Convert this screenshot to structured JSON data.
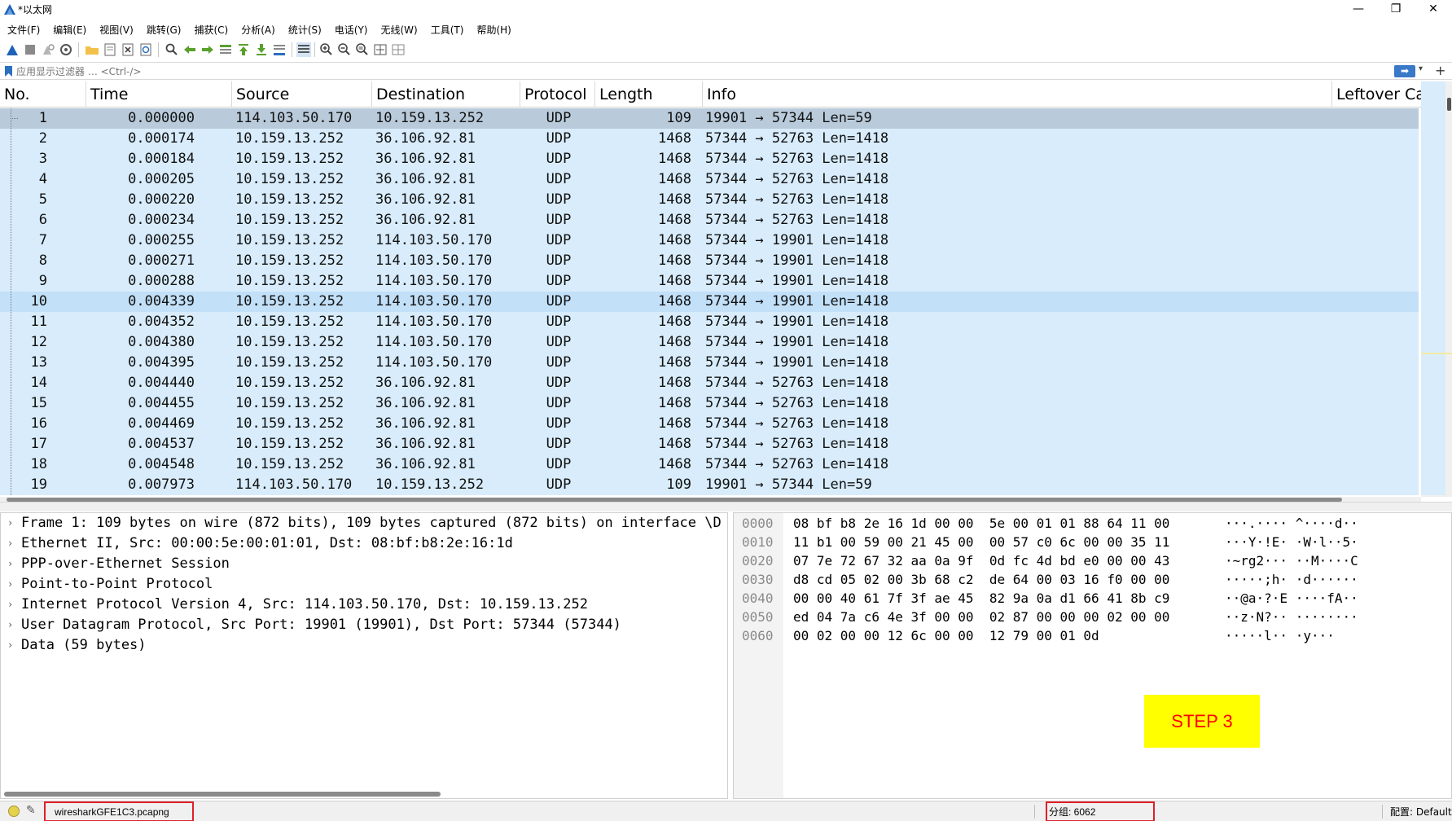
{
  "window": {
    "title": "*以太网",
    "minimize": "—",
    "restore": "❐",
    "close": "✕"
  },
  "menu": [
    {
      "label": "文件(F)"
    },
    {
      "label": "编辑(E)"
    },
    {
      "label": "视图(V)"
    },
    {
      "label": "跳转(G)"
    },
    {
      "label": "捕获(C)"
    },
    {
      "label": "分析(A)"
    },
    {
      "label": "统计(S)"
    },
    {
      "label": "电话(Y)"
    },
    {
      "label": "无线(W)"
    },
    {
      "label": "工具(T)"
    },
    {
      "label": "帮助(H)"
    }
  ],
  "filter": {
    "placeholder": "应用显示过滤器 … <Ctrl-/>",
    "apply_icon": "arrow-right-icon",
    "add_icon": "+"
  },
  "packet_list": {
    "columns": [
      "No.",
      "Time",
      "Source",
      "Destination",
      "Protocol",
      "Length",
      "Info",
      "Leftover Ca"
    ],
    "rows": [
      {
        "no": "1",
        "time": "0.000000",
        "src": "114.103.50.170",
        "dst": "10.159.13.252",
        "proto": "UDP",
        "len": "109",
        "info": "19901 → 57344 Len=59"
      },
      {
        "no": "2",
        "time": "0.000174",
        "src": "10.159.13.252",
        "dst": "36.106.92.81",
        "proto": "UDP",
        "len": "1468",
        "info": "57344 → 52763 Len=1418"
      },
      {
        "no": "3",
        "time": "0.000184",
        "src": "10.159.13.252",
        "dst": "36.106.92.81",
        "proto": "UDP",
        "len": "1468",
        "info": "57344 → 52763 Len=1418"
      },
      {
        "no": "4",
        "time": "0.000205",
        "src": "10.159.13.252",
        "dst": "36.106.92.81",
        "proto": "UDP",
        "len": "1468",
        "info": "57344 → 52763 Len=1418"
      },
      {
        "no": "5",
        "time": "0.000220",
        "src": "10.159.13.252",
        "dst": "36.106.92.81",
        "proto": "UDP",
        "len": "1468",
        "info": "57344 → 52763 Len=1418"
      },
      {
        "no": "6",
        "time": "0.000234",
        "src": "10.159.13.252",
        "dst": "36.106.92.81",
        "proto": "UDP",
        "len": "1468",
        "info": "57344 → 52763 Len=1418"
      },
      {
        "no": "7",
        "time": "0.000255",
        "src": "10.159.13.252",
        "dst": "114.103.50.170",
        "proto": "UDP",
        "len": "1468",
        "info": "57344 → 19901 Len=1418"
      },
      {
        "no": "8",
        "time": "0.000271",
        "src": "10.159.13.252",
        "dst": "114.103.50.170",
        "proto": "UDP",
        "len": "1468",
        "info": "57344 → 19901 Len=1418"
      },
      {
        "no": "9",
        "time": "0.000288",
        "src": "10.159.13.252",
        "dst": "114.103.50.170",
        "proto": "UDP",
        "len": "1468",
        "info": "57344 → 19901 Len=1418"
      },
      {
        "no": "10",
        "time": "0.004339",
        "src": "10.159.13.252",
        "dst": "114.103.50.170",
        "proto": "UDP",
        "len": "1468",
        "info": "57344 → 19901 Len=1418"
      },
      {
        "no": "11",
        "time": "0.004352",
        "src": "10.159.13.252",
        "dst": "114.103.50.170",
        "proto": "UDP",
        "len": "1468",
        "info": "57344 → 19901 Len=1418"
      },
      {
        "no": "12",
        "time": "0.004380",
        "src": "10.159.13.252",
        "dst": "114.103.50.170",
        "proto": "UDP",
        "len": "1468",
        "info": "57344 → 19901 Len=1418"
      },
      {
        "no": "13",
        "time": "0.004395",
        "src": "10.159.13.252",
        "dst": "114.103.50.170",
        "proto": "UDP",
        "len": "1468",
        "info": "57344 → 19901 Len=1418"
      },
      {
        "no": "14",
        "time": "0.004440",
        "src": "10.159.13.252",
        "dst": "36.106.92.81",
        "proto": "UDP",
        "len": "1468",
        "info": "57344 → 52763 Len=1418"
      },
      {
        "no": "15",
        "time": "0.004455",
        "src": "10.159.13.252",
        "dst": "36.106.92.81",
        "proto": "UDP",
        "len": "1468",
        "info": "57344 → 52763 Len=1418"
      },
      {
        "no": "16",
        "time": "0.004469",
        "src": "10.159.13.252",
        "dst": "36.106.92.81",
        "proto": "UDP",
        "len": "1468",
        "info": "57344 → 52763 Len=1418"
      },
      {
        "no": "17",
        "time": "0.004537",
        "src": "10.159.13.252",
        "dst": "36.106.92.81",
        "proto": "UDP",
        "len": "1468",
        "info": "57344 → 52763 Len=1418"
      },
      {
        "no": "18",
        "time": "0.004548",
        "src": "10.159.13.252",
        "dst": "36.106.92.81",
        "proto": "UDP",
        "len": "1468",
        "info": "57344 → 52763 Len=1418"
      },
      {
        "no": "19",
        "time": "0.007973",
        "src": "114.103.50.170",
        "dst": "10.159.13.252",
        "proto": "UDP",
        "len": "109",
        "info": "19901 → 57344 Len=59"
      }
    ]
  },
  "details": [
    "Frame 1: 109 bytes on wire (872 bits), 109 bytes captured (872 bits) on interface \\D",
    "Ethernet II, Src: 00:00:5e:00:01:01, Dst: 08:bf:b8:2e:16:1d",
    "PPP-over-Ethernet Session",
    "Point-to-Point Protocol",
    "Internet Protocol Version 4, Src: 114.103.50.170, Dst: 10.159.13.252",
    "User Datagram Protocol, Src Port: 19901 (19901), Dst Port: 57344 (57344)",
    "Data (59 bytes)"
  ],
  "bytes": [
    {
      "off": "0000",
      "hex": "08 bf b8 2e 16 1d 00 00  5e 00 01 01 88 64 11 00",
      "ascii": "···.···· ^····d··"
    },
    {
      "off": "0010",
      "hex": "11 b1 00 59 00 21 45 00  00 57 c0 6c 00 00 35 11",
      "ascii": "···Y·!E· ·W·l··5·"
    },
    {
      "off": "0020",
      "hex": "07 7e 72 67 32 aa 0a 9f  0d fc 4d bd e0 00 00 43",
      "ascii": "·~rg2··· ··M····C"
    },
    {
      "off": "0030",
      "hex": "d8 cd 05 02 00 3b 68 c2  de 64 00 03 16 f0 00 00",
      "ascii": "·····;h· ·d······"
    },
    {
      "off": "0040",
      "hex": "00 00 40 61 7f 3f ae 45  82 9a 0a d1 66 41 8b c9",
      "ascii": "··@a·?·E ····fA··"
    },
    {
      "off": "0050",
      "hex": "ed 04 7a c6 4e 3f 00 00  02 87 00 00 00 02 00 00",
      "ascii": "··z·N?·· ········"
    },
    {
      "off": "0060",
      "hex": "00 02 00 00 12 6c 00 00  12 79 00 01 0d",
      "ascii": "·····l·· ·y···"
    }
  ],
  "annotation": {
    "label": "STEP 3"
  },
  "status": {
    "file": "wiresharkGFE1C3.pcapng",
    "packets": "分组: 6062",
    "profile": "配置: Default"
  },
  "colors": {
    "row_bg": "#d8ecfb",
    "row_selected": "#b9cbdb",
    "annotation_border": "#e0202a",
    "step_bg": "#ffff00",
    "step_text": "#ff0000"
  }
}
